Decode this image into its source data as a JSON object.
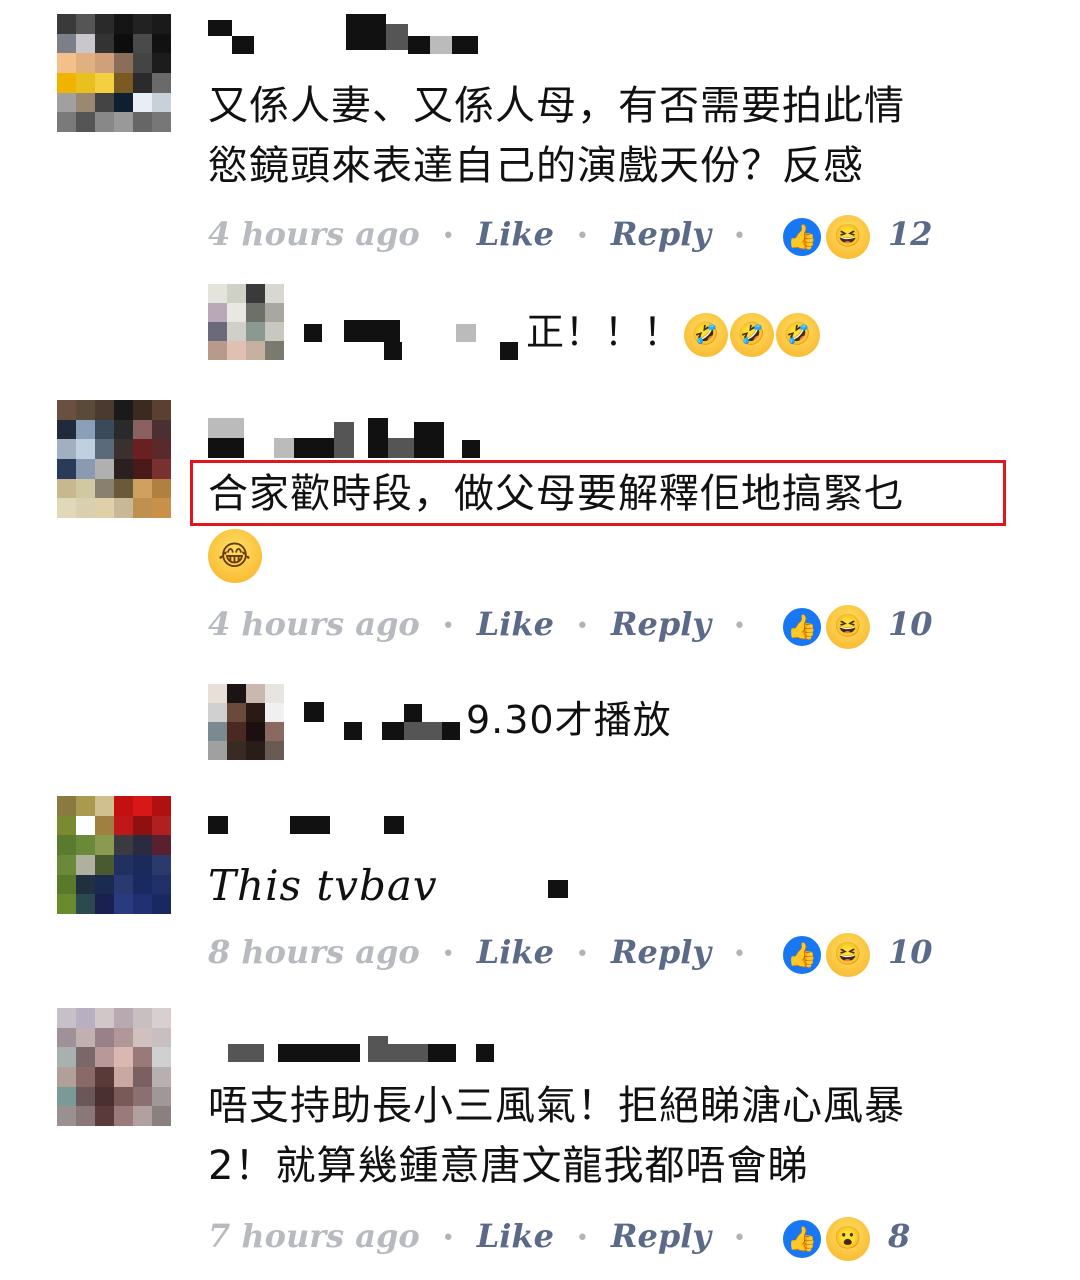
{
  "comments": [
    {
      "text_lines": [
        "又係人妻、又係人母，有否需要拍此情",
        "慾鏡頭來表達自己的演戲天份？反感"
      ],
      "time": "4 hours ago",
      "like": "Like",
      "reply": "Reply",
      "reactions": [
        "like",
        "haha"
      ],
      "count": "12"
    },
    {
      "reply_text": "正！！！",
      "emoji": [
        "rofl",
        "rofl",
        "rofl"
      ]
    },
    {
      "text_lines": [
        "合家歡時段，做父母要解釋佢地搞緊乜"
      ],
      "emoji_line": [
        "joy"
      ],
      "time": "4 hours ago",
      "like": "Like",
      "reply": "Reply",
      "reactions": [
        "like",
        "haha"
      ],
      "count": "10",
      "highlighted": true,
      "highlight_color": "#e3141d"
    },
    {
      "reply_text": "9.30才播放"
    },
    {
      "text_lines": [
        "This tvbav"
      ],
      "time": "8 hours ago",
      "like": "Like",
      "reply": "Reply",
      "reactions": [
        "like",
        "haha"
      ],
      "count": "10"
    },
    {
      "text_lines": [
        "唔支持助長小三風氣！拒絕睇溏心風暴",
        "2！就算幾鍾意唐文龍我都唔會睇"
      ],
      "time": "7 hours ago",
      "like": "Like",
      "reply": "Reply",
      "reactions": [
        "like",
        "wow"
      ],
      "count": "8"
    }
  ],
  "colors": {
    "like_blue": "#1877f2",
    "link_gray_blue": "#5b6a88",
    "meta_gray": "#8a8d91"
  }
}
